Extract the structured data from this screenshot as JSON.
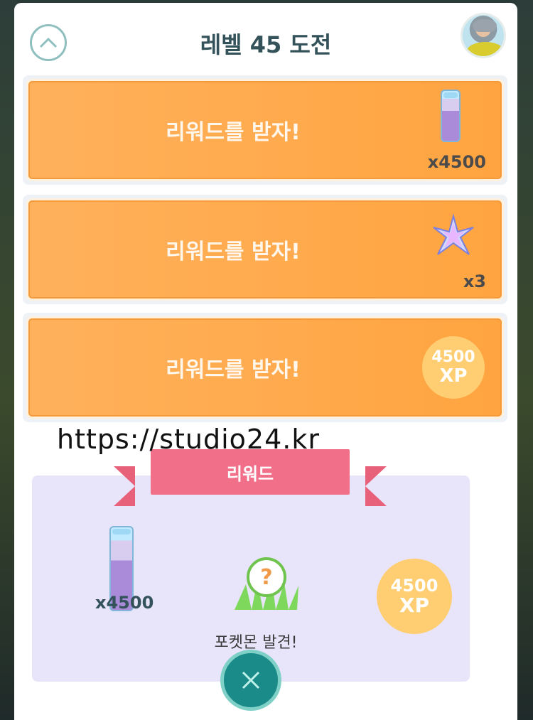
{
  "header": {
    "title_prefix": "레벨",
    "title_level": "45",
    "title_suffix": "도전"
  },
  "rewards": [
    {
      "label": "리워드를 받자!",
      "item": "stardust-vial",
      "count": "x4500"
    },
    {
      "label": "리워드를 받자!",
      "item": "star-piece",
      "count": "x3"
    },
    {
      "label": "리워드를 받자!",
      "item": "xp",
      "xp_value": "4500",
      "xp_unit": "XP"
    }
  ],
  "overlay": {
    "watermark_url": "https://studio24.kr"
  },
  "summary": {
    "ribbon_label": "리워드",
    "stardust_count": "x4500",
    "encounter_caption": "포켓몬 발견!",
    "xp_value": "4500",
    "xp_unit": "XP"
  },
  "colors": {
    "orange": "#ffa440",
    "teal": "#1b8b8a",
    "ribbon_pink": "#f26f8a",
    "summary_bg": "#e8e5fb",
    "xp_badge": "#ffce72"
  }
}
